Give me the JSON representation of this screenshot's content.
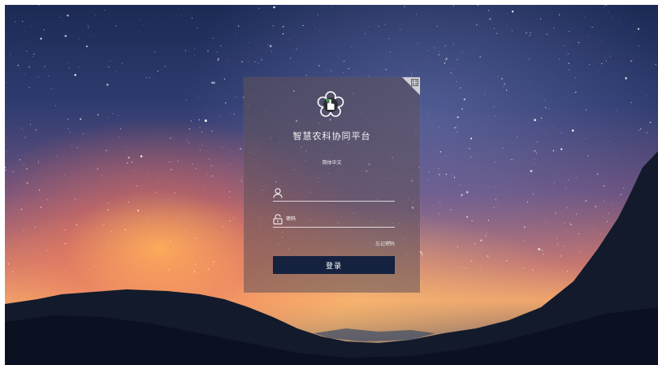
{
  "app": {
    "title": "智慧农科协同平台",
    "language": "简体中文"
  },
  "form": {
    "username_placeholder": "",
    "password_placeholder": "密码",
    "forgot_label": "忘记密码",
    "login_label": "登录"
  },
  "icons": {
    "logo": "flower-hand-logo-icon",
    "qr": "qr-code-icon",
    "user": "user-icon",
    "lock": "lock-icon"
  },
  "colors": {
    "button_bg": "#15223f",
    "card_bg": "rgba(96,82,90,0.55)",
    "logo_green": "#3d9a4a"
  }
}
